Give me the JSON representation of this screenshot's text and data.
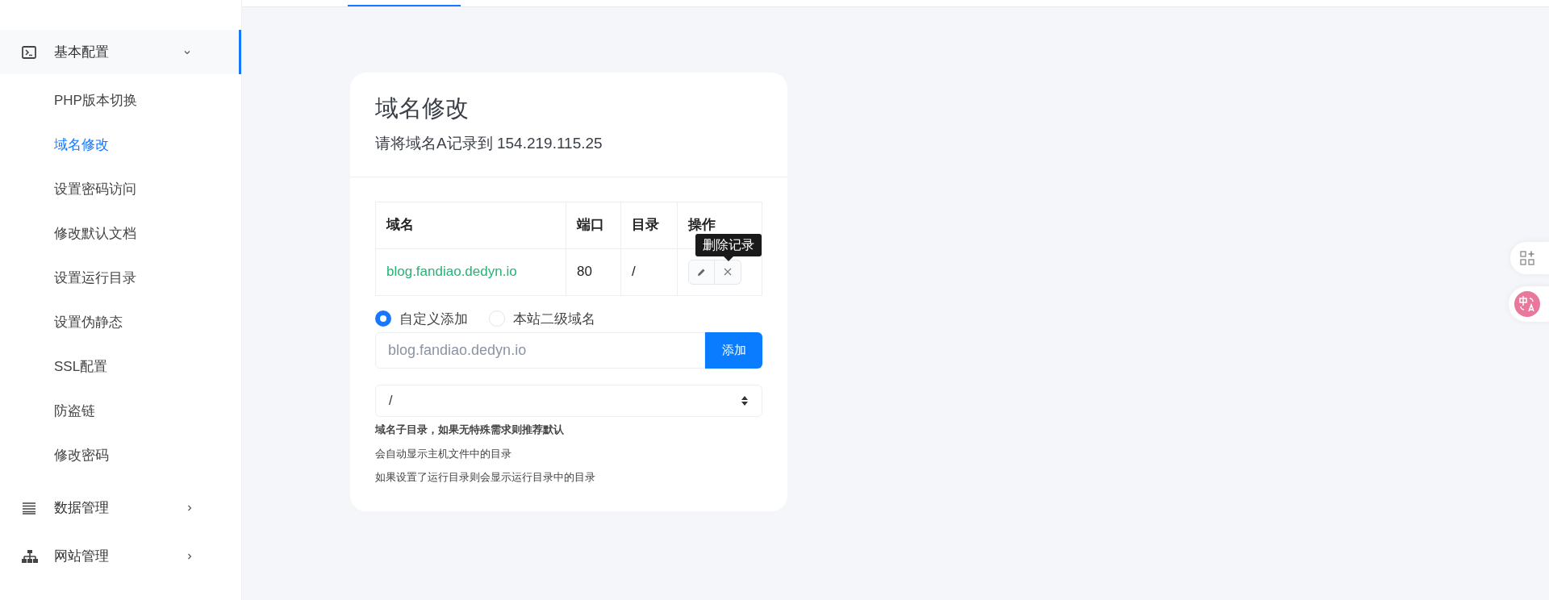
{
  "sidebar": {
    "groups": [
      {
        "label": "基本配置",
        "kind": "terminal",
        "expanded": true,
        "selected": true,
        "children": [
          {
            "label": "PHP版本切换",
            "selected": false
          },
          {
            "label": "域名修改",
            "selected": true
          },
          {
            "label": "设置密码访问",
            "selected": false
          },
          {
            "label": "修改默认文档",
            "selected": false
          },
          {
            "label": "设置运行目录",
            "selected": false
          },
          {
            "label": "设置伪静态",
            "selected": false
          },
          {
            "label": "SSL配置",
            "selected": false
          },
          {
            "label": "防盗链",
            "selected": false
          },
          {
            "label": "修改密码",
            "selected": false
          }
        ]
      },
      {
        "label": "数据管理",
        "kind": "list",
        "expanded": false,
        "selected": false
      },
      {
        "label": "网站管理",
        "kind": "sitemap",
        "expanded": false,
        "selected": false
      }
    ]
  },
  "card": {
    "title": "域名修改",
    "subtitle": "请将域名A记录到 154.219.115.25",
    "table": {
      "columns": [
        "域名",
        "端口",
        "目录",
        "操作"
      ],
      "rows": [
        {
          "domain": "blog.fandiao.dedyn.io",
          "port": "80",
          "dir": "/"
        }
      ],
      "tooltip": "删除记录"
    },
    "radios": [
      {
        "label": "自定义添加",
        "selected": true
      },
      {
        "label": "本站二级域名",
        "selected": false
      }
    ],
    "domain_input": {
      "placeholder": "blog.fandiao.dedyn.io"
    },
    "add_button": "添加",
    "dir_select": {
      "value": "/"
    },
    "notes": [
      {
        "text": "域名子目录，如果无特殊需求则推荐默认",
        "bold": true
      },
      {
        "text": "会自动显示主机文件中的目录",
        "bold": false
      },
      {
        "text": "如果设置了运行目录则会显示运行目录中的目录",
        "bold": false
      }
    ]
  }
}
